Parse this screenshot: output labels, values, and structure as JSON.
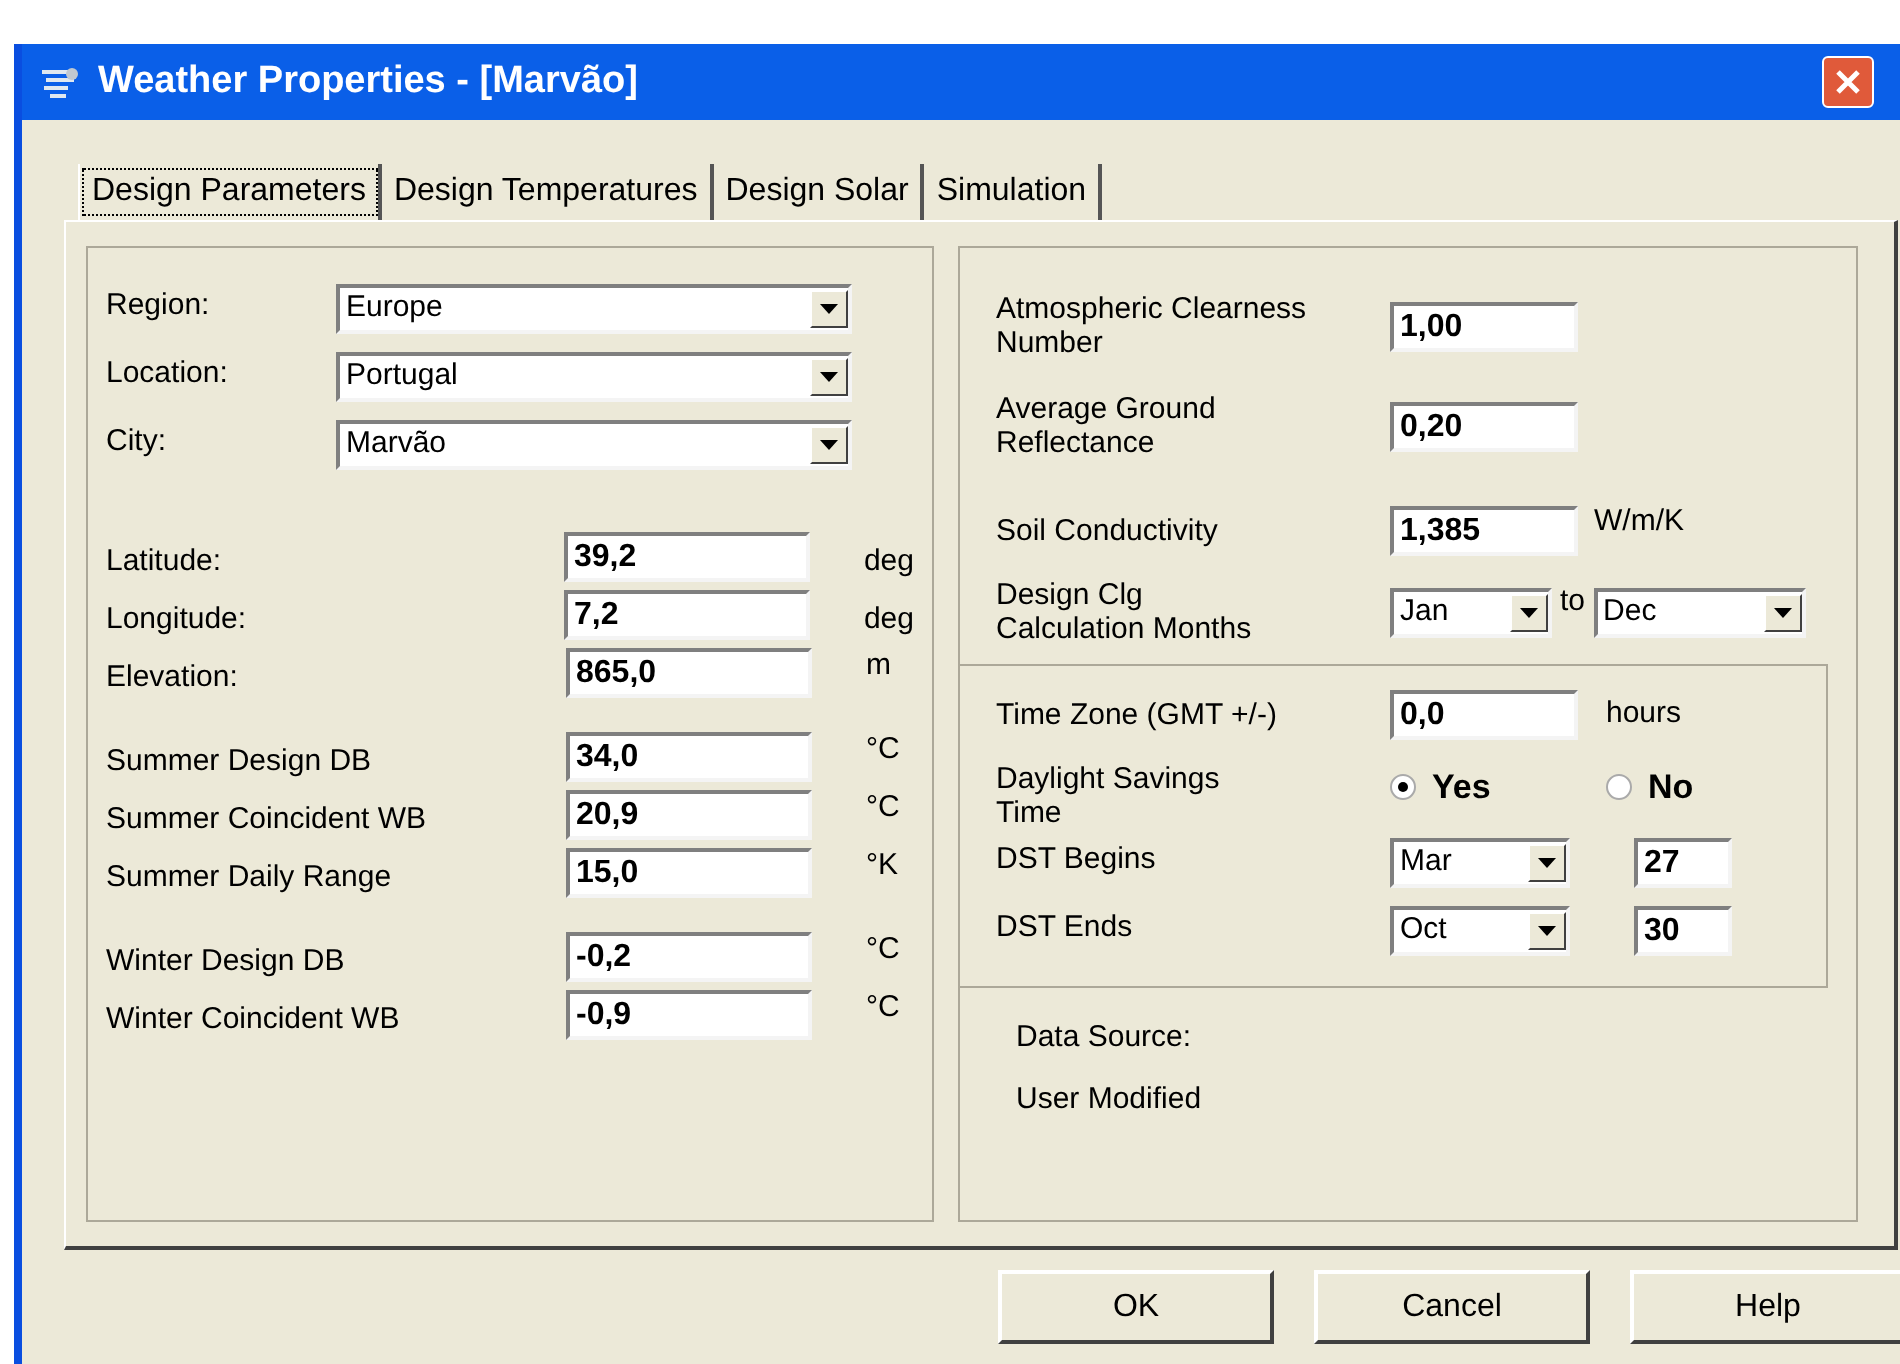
{
  "window": {
    "title": "Weather Properties - [Marvão]"
  },
  "tabs": [
    {
      "label": "Design Parameters",
      "selected": true
    },
    {
      "label": "Design Temperatures",
      "selected": false
    },
    {
      "label": "Design Solar",
      "selected": false
    },
    {
      "label": "Simulation",
      "selected": false
    }
  ],
  "location": [
    {
      "label": "Region:",
      "value": "Europe"
    },
    {
      "label": "Location:",
      "value": "Portugal"
    },
    {
      "label": "City:",
      "value": "Marvão"
    }
  ],
  "parameter_groups": [
    [
      {
        "label": "Latitude:",
        "value": "39,2",
        "unit": "deg"
      },
      {
        "label": "Longitude:",
        "value": "7,2",
        "unit": "deg"
      },
      {
        "label": "Elevation:",
        "value": "865,0",
        "unit": "m"
      }
    ],
    [
      {
        "label": "Summer Design DB",
        "value": "34,0",
        "unit": "°C"
      },
      {
        "label": "Summer Coincident WB",
        "value": "20,9",
        "unit": "°C"
      },
      {
        "label": "Summer Daily Range",
        "value": "15,0",
        "unit": "°K"
      }
    ],
    [
      {
        "label": "Winter Design DB",
        "value": "-0,2",
        "unit": "°C"
      },
      {
        "label": "Winter Coincident WB",
        "value": "-0,9",
        "unit": "°C"
      }
    ]
  ],
  "solar": [
    {
      "label": "Atmospheric Clearness\nNumber",
      "value": "1,00"
    },
    {
      "label": "Average Ground\nReflectance",
      "value": "0,20"
    },
    {
      "label": "Soil Conductivity",
      "value": "1,385",
      "unit": "W/m/K"
    }
  ],
  "months": {
    "label": "Design Clg\nCalculation Months",
    "from": "Jan",
    "to_label": "to",
    "to": "Dec"
  },
  "time_zone": {
    "label": "Time Zone (GMT +/-)",
    "value": "0,0",
    "unit": "hours"
  },
  "daylight_savings": {
    "label": "Daylight Savings\nTime",
    "options": [
      {
        "label": "Yes",
        "selected": true
      },
      {
        "label": "No",
        "selected": false
      }
    ]
  },
  "dst": [
    {
      "label": "DST Begins",
      "month": "Mar",
      "day": "27"
    },
    {
      "label": "DST Ends",
      "month": "Oct",
      "day": "30"
    }
  ],
  "data_source": [
    "Data Source:",
    "User Modified"
  ],
  "buttons": [
    "OK",
    "Cancel",
    "Help"
  ]
}
